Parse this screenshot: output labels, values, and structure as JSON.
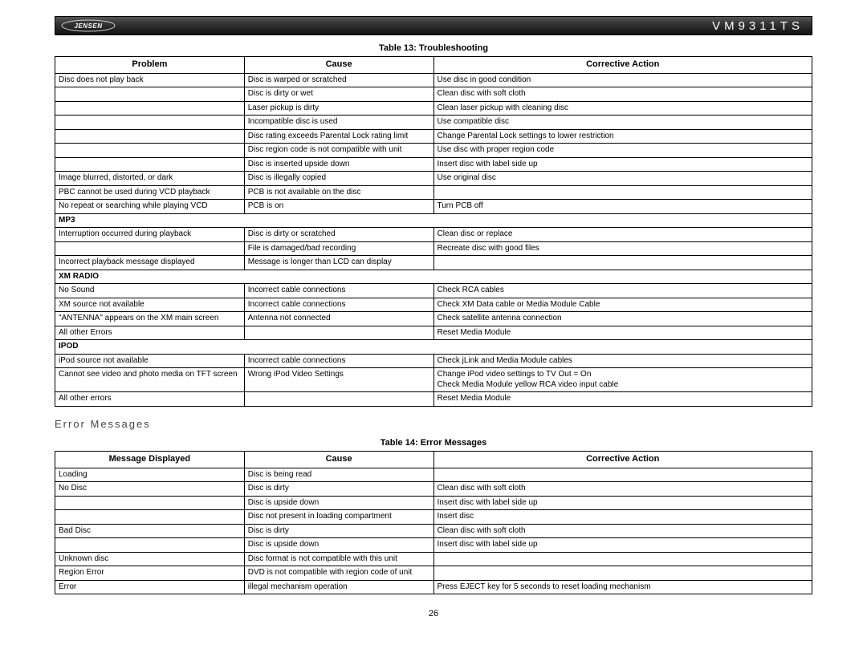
{
  "header": {
    "brand": "JENSEN",
    "model": "VM9311TS"
  },
  "table13": {
    "title": "Table 13: Troubleshooting",
    "headers": [
      "Problem",
      "Cause",
      "Corrective Action"
    ],
    "rows": [
      {
        "p": "Disc does not play back",
        "c": "Disc is warped or scratched",
        "a": "Use disc in good condition"
      },
      {
        "p": "",
        "c": "Disc is dirty or wet",
        "a": "Clean disc with soft cloth"
      },
      {
        "p": "",
        "c": "Laser pickup is dirty",
        "a": "Clean laser pickup with cleaning disc"
      },
      {
        "p": "",
        "c": "Incompatible disc is used",
        "a": "Use compatible disc"
      },
      {
        "p": "",
        "c": "Disc rating exceeds Parental Lock rating limit",
        "a": "Change Parental Lock settings to lower restriction"
      },
      {
        "p": "",
        "c": "Disc region code is not compatible with unit",
        "a": "Use disc with proper region code"
      },
      {
        "p": "",
        "c": "Disc is inserted upside down",
        "a": "Insert disc with label side up"
      },
      {
        "p": "Image blurred, distorted, or dark",
        "c": "Disc is illegally copied",
        "a": "Use original disc"
      },
      {
        "p": "PBC cannot be used during VCD playback",
        "c": "PCB is not available on the disc",
        "a": ""
      },
      {
        "p": "No repeat or searching while playing VCD",
        "c": "PCB is on",
        "a": "Turn PCB off"
      },
      {
        "section": "MP3"
      },
      {
        "p": "Interruption occurred during playback",
        "c": "Disc is dirty or scratched",
        "a": "Clean disc or replace"
      },
      {
        "p": "",
        "c": "File is damaged/bad recording",
        "a": "Recreate disc with good files"
      },
      {
        "p": "Incorrect playback message displayed",
        "c": "Message is longer than LCD can display",
        "a": ""
      },
      {
        "section": "XM RADIO"
      },
      {
        "p": "No Sound",
        "c": "Incorrect cable connections",
        "a": "Check RCA cables"
      },
      {
        "p": "XM source not available",
        "c": "Incorrect cable connections",
        "a": "Check XM Data cable or Media Module Cable"
      },
      {
        "p": "\"ANTENNA\" appears on the XM main screen",
        "c": "Antenna not connected",
        "a": "Check satellite antenna connection"
      },
      {
        "p": "All other Errors",
        "c": "",
        "a": "Reset Media Module"
      },
      {
        "section": "IPOD"
      },
      {
        "p": "iPod source not available",
        "c": "Incorrect cable connections",
        "a": "Check jLink and Media Module cables"
      },
      {
        "p": "Cannot see video and photo media on TFT screen",
        "c": "Wrong iPod Video Settings",
        "a": "Change iPod video settings to TV Out = On\nCheck Media Module yellow RCA video input cable"
      },
      {
        "p": "All other errors",
        "c": "",
        "a": "Reset Media Module"
      }
    ]
  },
  "errorHeading": "Error Messages",
  "table14": {
    "title": "Table 14: Error Messages",
    "headers": [
      "Message Displayed",
      "Cause",
      "Corrective Action"
    ],
    "rows": [
      {
        "p": "Loading",
        "c": "Disc is being read",
        "a": ""
      },
      {
        "p": "No Disc",
        "c": "Disc is dirty",
        "a": "Clean disc with soft cloth"
      },
      {
        "p": "",
        "c": "Disc is upside down",
        "a": "Insert disc with label side up"
      },
      {
        "p": "",
        "c": "Disc not present in loading compartment",
        "a": "Insert disc"
      },
      {
        "p": "Bad Disc",
        "c": "Disc is dirty",
        "a": "Clean disc with soft cloth"
      },
      {
        "p": "",
        "c": "Disc is upside down",
        "a": "Insert disc with label side up"
      },
      {
        "p": "Unknown disc",
        "c": "Disc format is not compatible with this unit",
        "a": ""
      },
      {
        "p": "Region Error",
        "c": "DVD is not compatible with region code of unit",
        "a": ""
      },
      {
        "p": "Error",
        "c": "illegal mechanism operation",
        "a": "Press EJECT key for 5 seconds to reset loading mechanism"
      }
    ]
  },
  "pageNumber": "26"
}
